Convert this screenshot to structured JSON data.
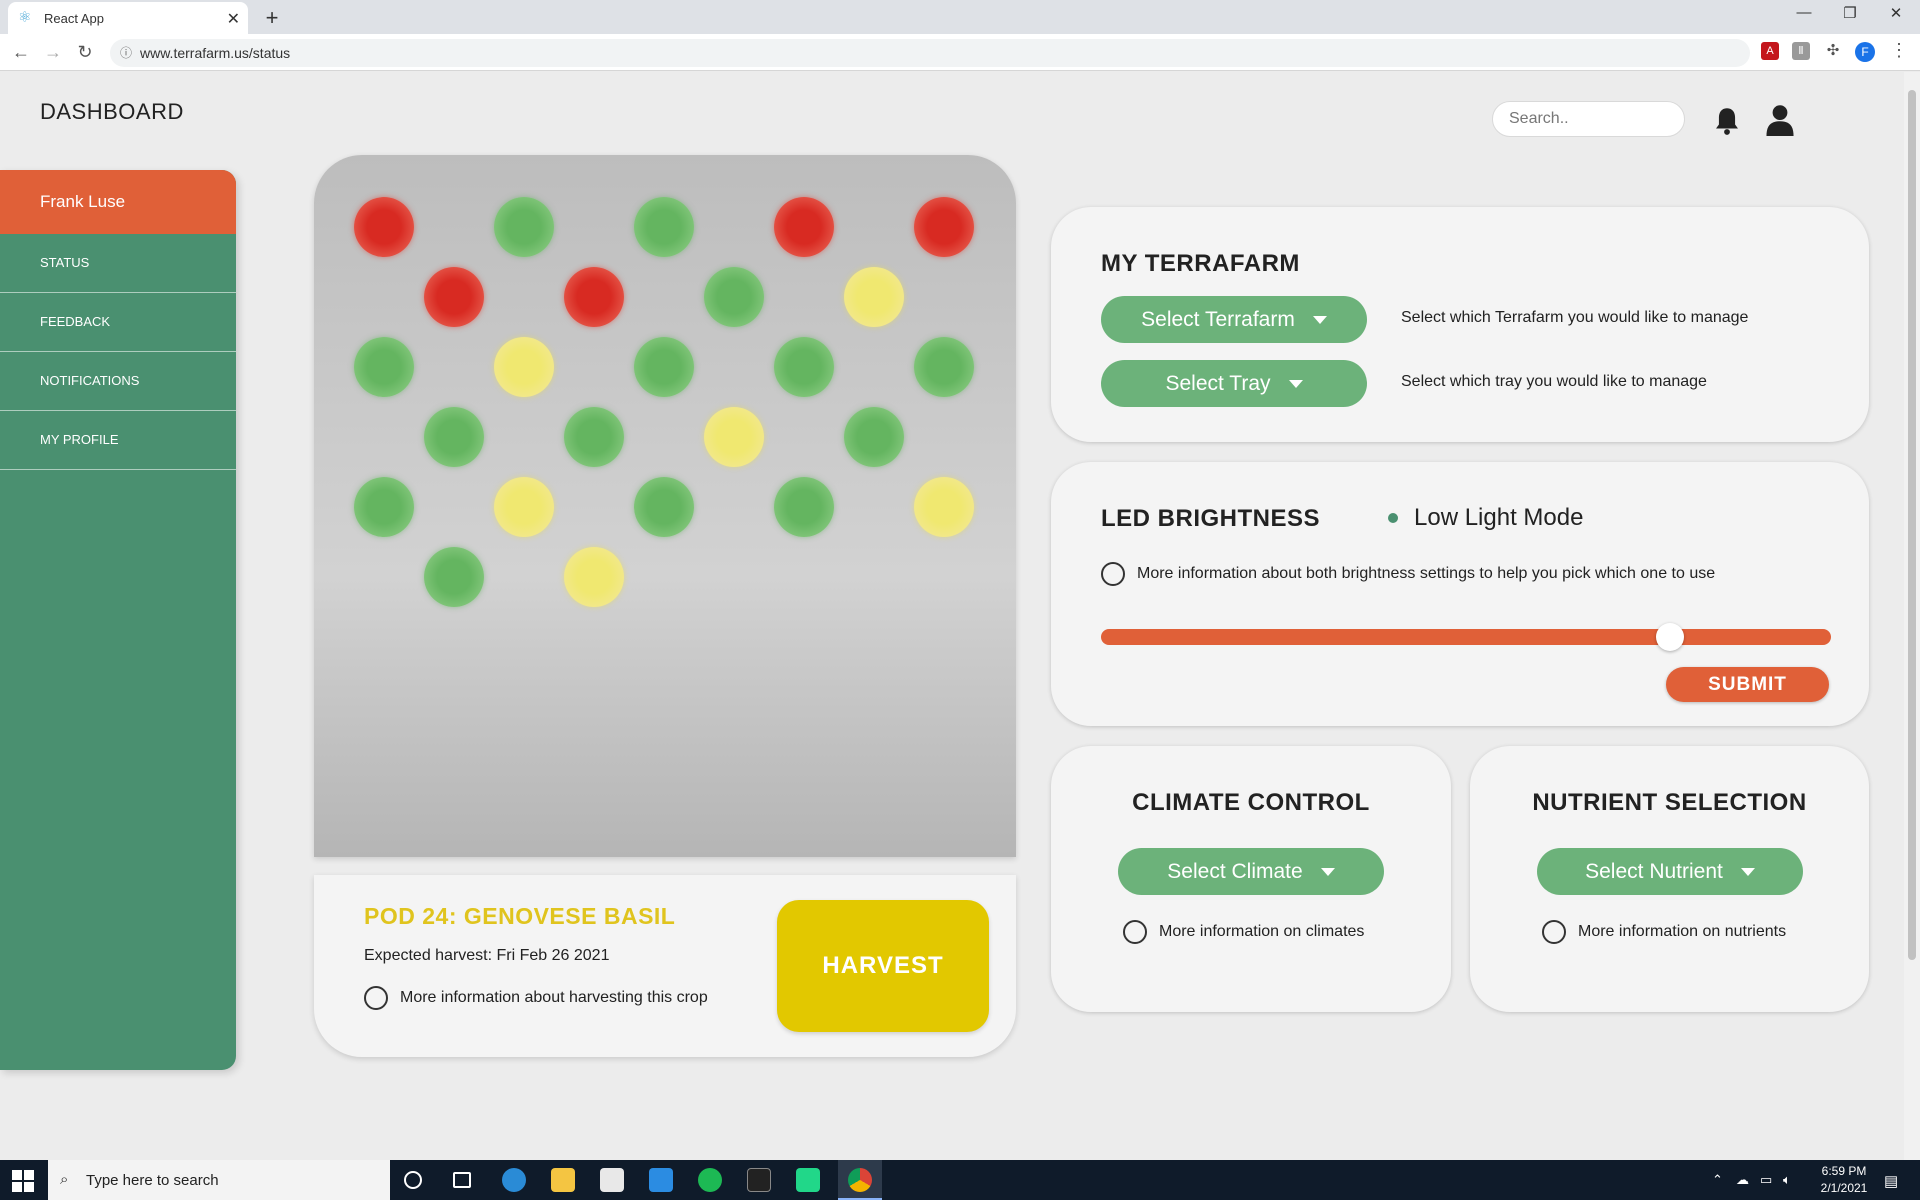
{
  "browser": {
    "tab_title": "React App",
    "url": "www.terrafarm.us/status"
  },
  "header": {
    "title": "DASHBOARD",
    "search_placeholder": "Search.."
  },
  "sidebar": {
    "user_name": "Frank Luse",
    "items": [
      {
        "label": "STATUS"
      },
      {
        "label": "FEEDBACK"
      },
      {
        "label": "NOTIFICATIONS"
      },
      {
        "label": "MY PROFILE"
      }
    ]
  },
  "tray": {
    "pods": [
      {
        "status": "red"
      },
      {
        "status": "green"
      },
      {
        "status": "green"
      },
      {
        "status": "red"
      },
      {
        "status": "red"
      },
      {
        "status": "red"
      },
      {
        "status": "red"
      },
      {
        "status": "green"
      },
      {
        "status": "yellow"
      },
      {
        "status": "green"
      },
      {
        "status": "yellow"
      },
      {
        "status": "green"
      },
      {
        "status": "green"
      },
      {
        "status": "green"
      },
      {
        "status": "green"
      },
      {
        "status": "green"
      },
      {
        "status": "yellow"
      },
      {
        "status": "green"
      },
      {
        "status": "green"
      },
      {
        "status": "yellow"
      },
      {
        "status": "green"
      },
      {
        "status": "green"
      },
      {
        "status": "yellow"
      },
      {
        "status": "green"
      },
      {
        "status": "yellow"
      }
    ],
    "colors": {
      "red": "#d82a22",
      "green": "#64b560",
      "yellow": "#f0e870"
    }
  },
  "pod_info": {
    "title": "POD 24: GENOVESE BASIL",
    "expected_harvest": "Expected harvest: Fri Feb 26 2021",
    "more_info": "More information about harvesting this crop",
    "harvest_button": "HARVEST"
  },
  "my_terrafarm": {
    "title": "MY TERRAFARM",
    "select_terrafarm": "Select Terrafarm",
    "select_terrafarm_desc": "Select which Terrafarm you would like to manage",
    "select_tray": "Select Tray",
    "select_tray_desc": "Select which tray you would like to manage"
  },
  "led": {
    "title": "LED BRIGHTNESS",
    "mode": "Low Light Mode",
    "more_info": "More information about both brightness settings to help you pick which one to use",
    "level": 0.79,
    "submit": "SUBMIT"
  },
  "climate": {
    "title": "CLIMATE CONTROL",
    "select": "Select Climate",
    "more_info": "More information on climates"
  },
  "nutrient": {
    "title": "NUTRIENT SELECTION",
    "select": "Select Nutrient",
    "more_info": "More information on nutrients"
  },
  "colors": {
    "accent_orange": "#e06038",
    "sidebar_green": "#4a9070",
    "button_green": "#6cb27a",
    "harvest_yellow": "#e2c800",
    "title_yellow": "#e0c41e"
  },
  "taskbar": {
    "search_placeholder": "Type here to search",
    "time": "6:59 PM",
    "date": "2/1/2021"
  }
}
